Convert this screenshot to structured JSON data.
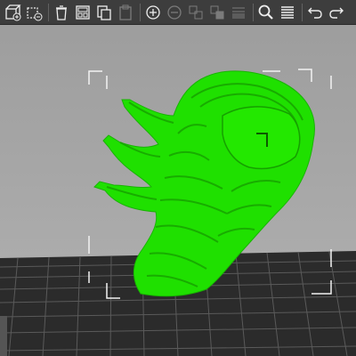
{
  "app": {
    "view": "3D",
    "accent_model_color": "#1fe000",
    "bed_color": "#2b2b2b",
    "bed_grid_color": "#5f5f5f",
    "bounding_box_color": "#f2f2f2",
    "toolbar_bg": "#3d3d3d"
  },
  "toolbar": {
    "tools": [
      {
        "icon": "add-object-icon",
        "enabled": true
      },
      {
        "icon": "delete-object-icon",
        "enabled": true
      },
      {
        "icon": "delete-all-icon",
        "enabled": true
      },
      {
        "icon": "arrange-icon",
        "enabled": true
      },
      {
        "icon": "copy-icon",
        "enabled": true
      },
      {
        "icon": "paste-icon",
        "enabled": false
      },
      {
        "icon": "add-instance-icon",
        "enabled": true
      },
      {
        "icon": "remove-instance-icon",
        "enabled": false
      },
      {
        "icon": "split-objects-icon",
        "enabled": false
      },
      {
        "icon": "split-parts-icon",
        "enabled": false
      },
      {
        "icon": "variable-layer-height-icon",
        "enabled": false
      },
      {
        "icon": "search-icon",
        "enabled": true
      },
      {
        "icon": "layers-icon",
        "enabled": true
      },
      {
        "icon": "undo-icon",
        "enabled": true
      },
      {
        "icon": "redo-icon",
        "enabled": true
      }
    ]
  },
  "model": {
    "name": "",
    "selected": true
  }
}
